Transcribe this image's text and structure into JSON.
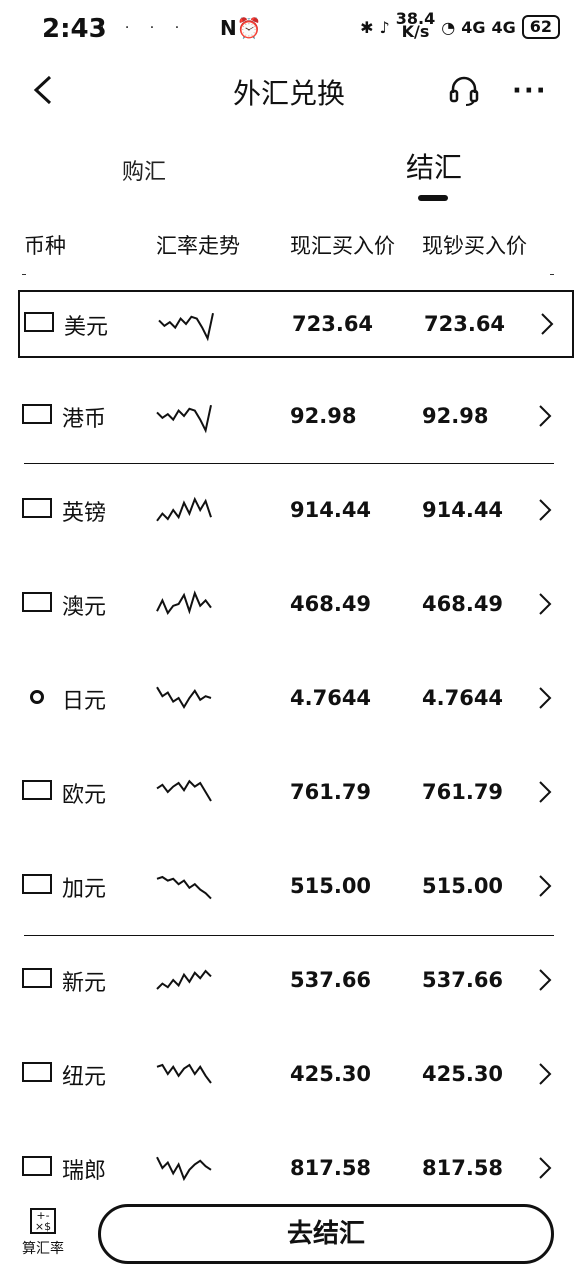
{
  "status_bar": {
    "time": "2:43",
    "left_icons": "· · · ·",
    "nfc": "N⏰",
    "speed_value": "38.4",
    "speed_unit": "K/s",
    "net1": "4G",
    "net2": "4G",
    "battery": "62"
  },
  "header": {
    "title": "外汇兑换",
    "more": "···"
  },
  "tabs": {
    "buy": "购汇",
    "sell": "结汇"
  },
  "columns": {
    "currency": "币种",
    "trend": "汇率走势",
    "spot_buy": "现汇买入价",
    "cash_buy": "现钞买入价"
  },
  "rows": [
    {
      "name": "美元",
      "spot": "723.64",
      "cash": "723.64",
      "flag": "us-flag-icon",
      "trend": [
        0.4,
        0.55,
        0.45,
        0.6,
        0.35,
        0.5,
        0.3,
        0.35,
        0.6,
        0.9,
        0.2
      ]
    },
    {
      "name": "港币",
      "spot": "92.98",
      "cash": "92.98",
      "flag": "hk-flag-icon",
      "trend": [
        0.4,
        0.55,
        0.45,
        0.6,
        0.35,
        0.5,
        0.3,
        0.35,
        0.6,
        0.9,
        0.2
      ]
    },
    {
      "name": "英镑",
      "spot": "914.44",
      "cash": "914.44",
      "flag": "uk-flag-icon",
      "trend": [
        0.8,
        0.6,
        0.75,
        0.5,
        0.7,
        0.3,
        0.6,
        0.2,
        0.5,
        0.25,
        0.7
      ]
    },
    {
      "name": "澳元",
      "spot": "468.49",
      "cash": "468.49",
      "flag": "au-flag-icon",
      "trend": [
        0.7,
        0.4,
        0.75,
        0.55,
        0.5,
        0.25,
        0.7,
        0.2,
        0.55,
        0.4,
        0.6
      ]
    },
    {
      "name": "日元",
      "spot": "4.7644",
      "cash": "4.7644",
      "flag": "jp-flag-icon",
      "trend": [
        0.2,
        0.45,
        0.35,
        0.6,
        0.5,
        0.75,
        0.5,
        0.3,
        0.55,
        0.45,
        0.5
      ]
    },
    {
      "name": "欧元",
      "spot": "761.79",
      "cash": "761.79",
      "flag": "eu-flag-icon",
      "trend": [
        0.4,
        0.3,
        0.5,
        0.35,
        0.25,
        0.45,
        0.2,
        0.35,
        0.25,
        0.5,
        0.75
      ]
    },
    {
      "name": "加元",
      "spot": "515.00",
      "cash": "515.00",
      "flag": "ca-flag-icon",
      "trend": [
        0.3,
        0.25,
        0.35,
        0.3,
        0.45,
        0.35,
        0.55,
        0.45,
        0.6,
        0.7,
        0.85
      ]
    },
    {
      "name": "新元",
      "spot": "537.66",
      "cash": "537.66",
      "flag": "sg-flag-icon",
      "trend": [
        0.75,
        0.6,
        0.7,
        0.5,
        0.65,
        0.35,
        0.55,
        0.3,
        0.45,
        0.25,
        0.4
      ]
    },
    {
      "name": "纽元",
      "spot": "425.30",
      "cash": "425.30",
      "flag": "nz-flag-icon",
      "trend": [
        0.3,
        0.25,
        0.5,
        0.3,
        0.55,
        0.35,
        0.25,
        0.5,
        0.3,
        0.55,
        0.75
      ]
    },
    {
      "name": "瑞郎",
      "spot": "817.58",
      "cash": "817.58",
      "flag": "ch-flag-icon",
      "trend": [
        0.2,
        0.5,
        0.35,
        0.65,
        0.4,
        0.8,
        0.55,
        0.4,
        0.3,
        0.45,
        0.55
      ]
    }
  ],
  "bottom": {
    "calc_label": "算汇率",
    "calc_icon": "+-×$",
    "cta": "去结汇"
  }
}
